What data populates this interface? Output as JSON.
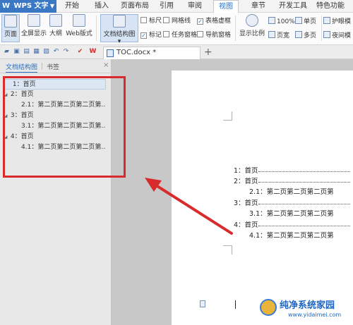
{
  "app": {
    "name": "WPS 文字",
    "logo": "W"
  },
  "menu_tabs": [
    "开始",
    "插入",
    "页面布局",
    "引用",
    "审阅",
    "视图",
    "章节",
    "开发工具",
    "特色功能"
  ],
  "active_menu_tab": "视图",
  "ribbon": {
    "view_buttons": [
      "页面",
      "全屏显示",
      "大纲",
      "Web版式"
    ],
    "doc_structure": "文档结构图",
    "checkboxes_col1": [
      {
        "label": "标尺",
        "checked": false
      },
      {
        "label": "标记",
        "checked": true
      }
    ],
    "checkboxes_col2": [
      {
        "label": "网格线",
        "checked": false
      },
      {
        "label": "任务窗格",
        "checked": false
      }
    ],
    "checkboxes_col3": [
      {
        "label": "表格虚框",
        "checked": true
      },
      {
        "label": "导航窗格",
        "checked": false
      }
    ],
    "zoom_label": "显示比例",
    "zoom_percent": "100%",
    "page_width": "页宽",
    "single_page": "单页",
    "multi_page": "多页",
    "eye_care": "护眼模",
    "night_mode": "夜间模"
  },
  "doc_tab": {
    "name": "TOC.docx *"
  },
  "nav_pane": {
    "tab_outline": "文档结构图",
    "tab_bookmark": "书签",
    "close": "×",
    "items": [
      {
        "text": "1：首页",
        "collapsible": false
      },
      {
        "text": "2：首页",
        "collapsible": true
      },
      {
        "text": "2.1：第二页第二页第二页第…",
        "collapsible": false
      },
      {
        "text": "3：首页",
        "collapsible": true
      },
      {
        "text": "3.1：第二页第二页第二页第…",
        "collapsible": false
      },
      {
        "text": "4：首页",
        "collapsible": true
      },
      {
        "text": "4.1：第二页第二页第二页第…",
        "collapsible": false
      }
    ]
  },
  "toc": [
    "1：首页",
    "2：首页",
    "2.1：第二页第二页第二页第",
    "3：首页",
    "3.1：第二页第二页第二页第",
    "4：首页",
    "4.1：第二页第二页第二页第"
  ],
  "watermark": {
    "text": "纯净系统家园",
    "url": "www.yidaimei.com"
  },
  "colors": {
    "accent": "#2b6fc4",
    "annotation_red": "#d92b2b",
    "app_blue": "#3a78c4"
  }
}
